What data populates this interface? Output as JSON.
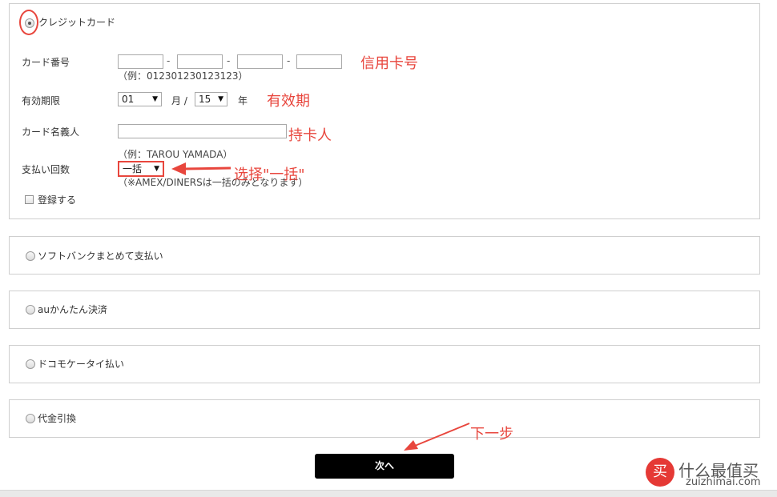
{
  "payment_methods": {
    "credit_card": {
      "label": "クレジットカード",
      "selected": true
    },
    "softbank": {
      "label": "ソフトバンクまとめて支払い"
    },
    "au": {
      "label": "auかんたん決済"
    },
    "docomo": {
      "label": "ドコモケータイ払い"
    },
    "cod": {
      "label": "代金引換"
    }
  },
  "card_form": {
    "card_number_label": "カード番号",
    "card_number_hint": "（例：012301230123123）",
    "card_number_separators": [
      "-",
      "-",
      "-"
    ],
    "expiry_label": "有効期限",
    "expiry_month_value": "01",
    "expiry_month_unit": "月 /",
    "expiry_year_value": "15",
    "expiry_year_unit": "年",
    "holder_label": "カード名義人",
    "holder_hint": "（例：TAROU YAMADA）",
    "installments_label": "支払い回数",
    "installments_value": "一括",
    "installments_hint": "（※AMEX/DINERSは一括のみとなります）",
    "register_label": "登録する"
  },
  "annotations": {
    "card_number": "信用卡号",
    "expiry": "有效期",
    "holder": "持卡人",
    "installments": "选择\"一括\"",
    "next_step": "下一步",
    "color": "#e8463d"
  },
  "next_button_label": "次へ",
  "watermark": {
    "cn": "什么最值买",
    "url": "zuizhimai.com",
    "badge": "买",
    "badge_color": "#e53935"
  }
}
